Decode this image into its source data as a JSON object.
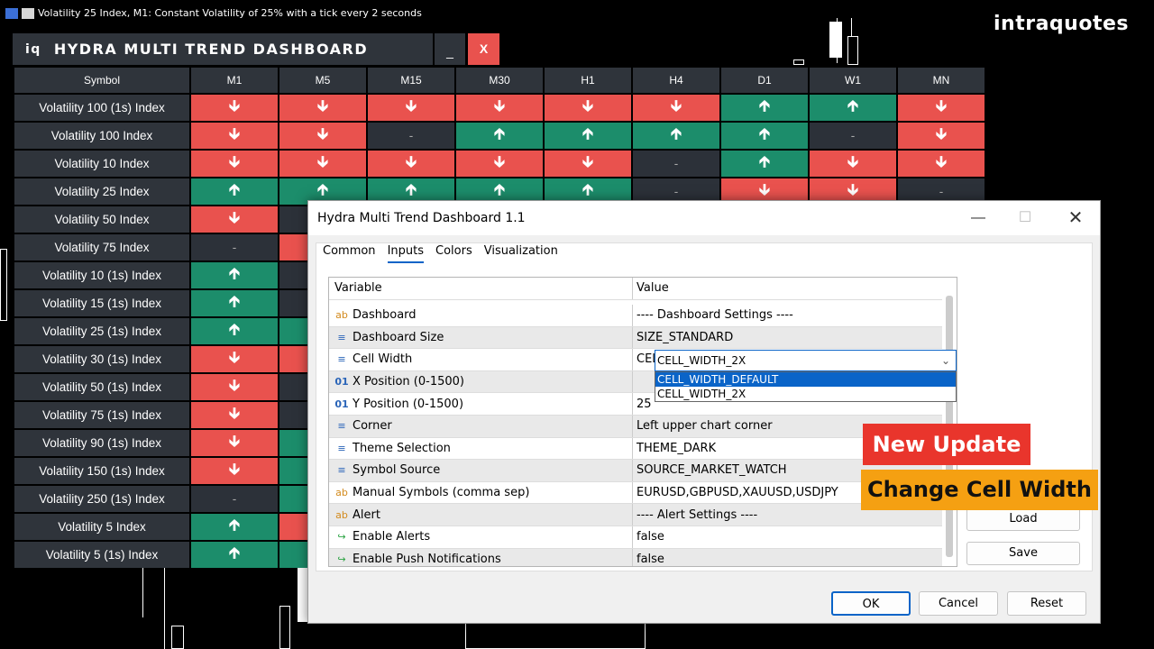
{
  "chart": {
    "title": "Volatility 25 Index, M1:  Constant Volatility of 25% with a tick every 2 seconds"
  },
  "brand": "intraquotes",
  "dashboard": {
    "logo": "iq",
    "title": "HYDRA MULTI TREND DASHBOARD",
    "min_label": "_",
    "close_label": "X",
    "symbol_header": "Symbol",
    "timeframes": [
      "M1",
      "M5",
      "M15",
      "M30",
      "H1",
      "H4",
      "D1",
      "W1",
      "MN"
    ],
    "rows": [
      {
        "symbol": "Volatility 100 (1s) Index",
        "signals": [
          "down",
          "down",
          "down",
          "down",
          "down",
          "down",
          "up",
          "up",
          "down"
        ]
      },
      {
        "symbol": "Volatility 100 Index",
        "signals": [
          "down",
          "down",
          "neutral",
          "up",
          "up",
          "up",
          "up",
          "neutral",
          "down"
        ]
      },
      {
        "symbol": "Volatility 10 Index",
        "signals": [
          "down",
          "down",
          "down",
          "down",
          "down",
          "neutral",
          "up",
          "down",
          "down"
        ]
      },
      {
        "symbol": "Volatility 25 Index",
        "signals": [
          "up",
          "up",
          "up",
          "up",
          "up",
          "neutral",
          "down",
          "down",
          "neutral"
        ]
      },
      {
        "symbol": "Volatility 50 Index",
        "signals": [
          "down",
          "neutral"
        ]
      },
      {
        "symbol": "Volatility 75 Index",
        "signals": [
          "neutral",
          "down"
        ]
      },
      {
        "symbol": "Volatility 10 (1s) Index",
        "signals": [
          "up",
          "neutral"
        ]
      },
      {
        "symbol": "Volatility 15 (1s) Index",
        "signals": [
          "up",
          "neutral"
        ]
      },
      {
        "symbol": "Volatility 25 (1s) Index",
        "signals": [
          "up",
          "up"
        ]
      },
      {
        "symbol": "Volatility 30 (1s) Index",
        "signals": [
          "down",
          "down"
        ]
      },
      {
        "symbol": "Volatility 50 (1s) Index",
        "signals": [
          "down",
          "neutral"
        ]
      },
      {
        "symbol": "Volatility 75 (1s) Index",
        "signals": [
          "down",
          "neutral"
        ]
      },
      {
        "symbol": "Volatility 90 (1s) Index",
        "signals": [
          "down",
          "up"
        ]
      },
      {
        "symbol": "Volatility 150 (1s) Index",
        "signals": [
          "down",
          "up"
        ]
      },
      {
        "symbol": "Volatility 250 (1s) Index",
        "signals": [
          "neutral",
          "up"
        ]
      },
      {
        "symbol": "Volatility 5 Index",
        "signals": [
          "up",
          "down"
        ]
      },
      {
        "symbol": "Volatility 5 (1s) Index",
        "signals": [
          "up",
          "up"
        ]
      }
    ],
    "colors": {
      "up": "#1c8d6b",
      "down": "#e9524e",
      "neutral": "#2c3139",
      "header": "#2f343b"
    }
  },
  "dialog": {
    "title": "Hydra Multi Trend Dashboard 1.1",
    "tabs": [
      "Common",
      "Inputs",
      "Colors",
      "Visualization"
    ],
    "active_tab": "Inputs",
    "col_variable": "Variable",
    "col_value": "Value",
    "params": [
      {
        "icon": "ab",
        "name": "Dashboard",
        "value": "---- Dashboard Settings ----"
      },
      {
        "icon": "enum",
        "name": "Dashboard Size",
        "value": "SIZE_STANDARD"
      },
      {
        "icon": "enum",
        "name": "Cell Width",
        "value": "CELL_WIDTH_2X"
      },
      {
        "icon": "num",
        "name": "X Position (0-1500)",
        "value": ""
      },
      {
        "icon": "num",
        "name": "Y Position (0-1500)",
        "value": "25"
      },
      {
        "icon": "enum",
        "name": "Corner",
        "value": "Left upper chart corner"
      },
      {
        "icon": "enum",
        "name": "Theme Selection",
        "value": "THEME_DARK"
      },
      {
        "icon": "enum",
        "name": "Symbol Source",
        "value": "SOURCE_MARKET_WATCH"
      },
      {
        "icon": "ab",
        "name": "Manual Symbols (comma sep)",
        "value": "EURUSD,GBPUSD,XAUUSD,USDJPY"
      },
      {
        "icon": "ab",
        "name": "Alert",
        "value": "---- Alert Settings ----"
      },
      {
        "icon": "bool",
        "name": "Enable Alerts",
        "value": "false"
      },
      {
        "icon": "bool",
        "name": "Enable Push Notifications",
        "value": "false"
      }
    ],
    "dropdown_selected": "CELL_WIDTH_2X",
    "dropdown_options": [
      "CELL_WIDTH_DEFAULT",
      "CELL_WIDTH_2X"
    ],
    "load_label": "Load",
    "save_label": "Save",
    "ok_label": "OK",
    "cancel_label": "Cancel",
    "reset_label": "Reset"
  },
  "badges": {
    "new_update": "New Update",
    "change_cell_width": "Change Cell Width"
  }
}
